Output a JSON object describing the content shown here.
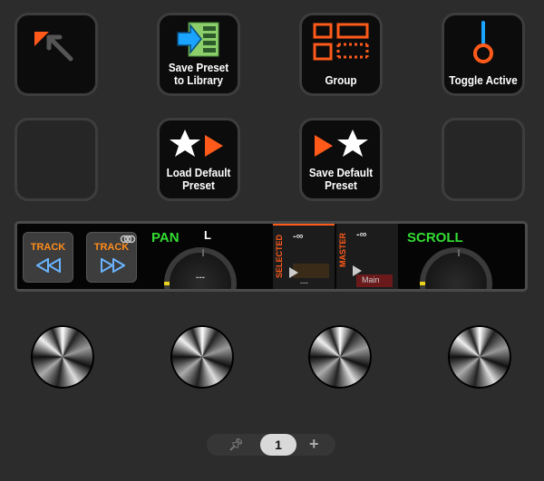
{
  "pads": {
    "row1": [
      {
        "label": "",
        "icon": "arrow-up-left-icon"
      },
      {
        "label": "Save Preset\nto Library",
        "icon": "save-preset-library-icon"
      },
      {
        "label": "Group",
        "icon": "group-icon"
      },
      {
        "label": "Toggle Active",
        "icon": "toggle-active-icon"
      }
    ],
    "row2": [
      {
        "label": "",
        "icon": ""
      },
      {
        "label": "Load Default\nPreset",
        "icon": "load-default-icon"
      },
      {
        "label": "Save Default\nPreset",
        "icon": "save-default-icon"
      },
      {
        "label": "",
        "icon": ""
      }
    ]
  },
  "strip": {
    "track_prev_label": "TRACK",
    "track_next_label": "TRACK",
    "pan_label": "PAN",
    "pan_side": "L",
    "pan_value": "---",
    "selected_label": "SELECTED",
    "selected_db": "-∞",
    "selected_value": "---",
    "master_label": "MASTER",
    "master_db": "-∞",
    "master_value": "Main",
    "scroll_label": "SCROLL"
  },
  "pager": {
    "page": "1",
    "pin_icon": "pin-icon",
    "add_icon": "plus-icon"
  },
  "colors": {
    "accent": "#ff5a1a",
    "green": "#33dd33",
    "track_orange": "#ff8c1a",
    "icon_blue": "#1aa3ff"
  }
}
